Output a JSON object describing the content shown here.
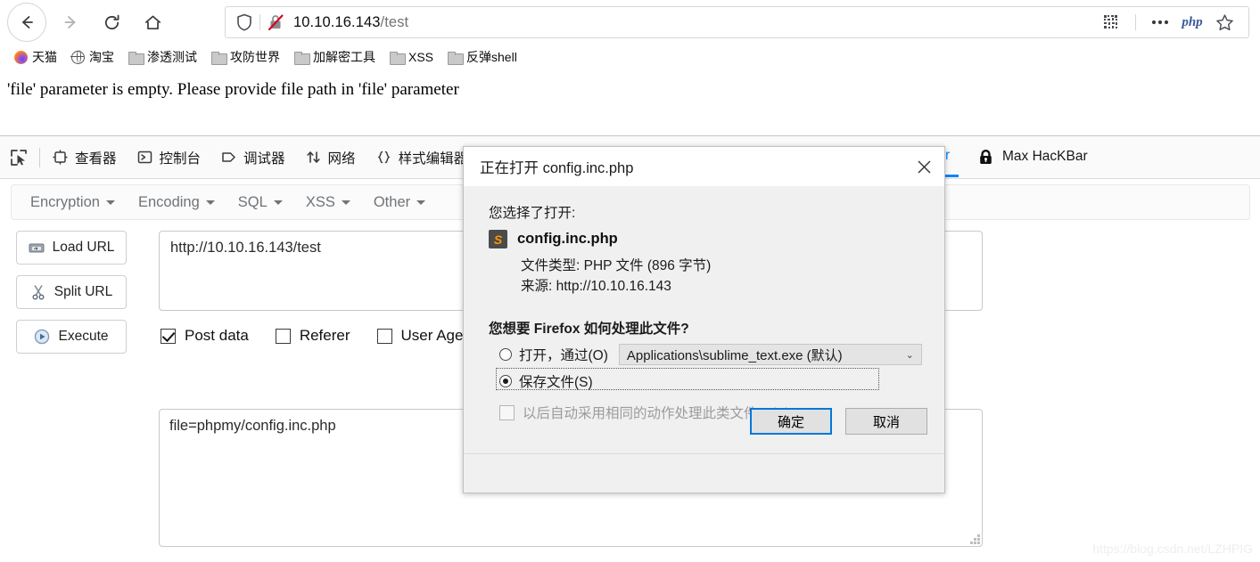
{
  "browser": {
    "nav": {
      "back_label": "←",
      "forward_label": "→",
      "reload_label": "⟳",
      "home_label": "⌂"
    },
    "url_bar": {
      "host": "10.10.16.143",
      "path": "/test",
      "shield_icon": "shield-icon",
      "insecure_icon": "crossed-lock-icon",
      "qr_icon": "qr-code-icon",
      "menu_icon": "ellipsis-icon",
      "php_badge": "php",
      "star_icon": "star-icon"
    },
    "bookmarks": [
      {
        "label": "天猫",
        "icon": "firefox-logo-icon"
      },
      {
        "label": "淘宝",
        "icon": "globe-icon"
      },
      {
        "label": "渗透测试",
        "icon": "folder-icon"
      },
      {
        "label": "攻防世界",
        "icon": "folder-icon"
      },
      {
        "label": "加解密工具",
        "icon": "folder-icon"
      },
      {
        "label": "XSS",
        "icon": "folder-icon"
      },
      {
        "label": "反弹shell",
        "icon": "folder-icon"
      }
    ]
  },
  "page": {
    "message": "'file' parameter is empty. Please provide file path in 'file' parameter"
  },
  "devtools": {
    "picker_icon": "element-picker-icon",
    "tabs": [
      {
        "label": "查看器",
        "icon": "inspector-icon"
      },
      {
        "label": "控制台",
        "icon": "console-icon"
      },
      {
        "label": "调试器",
        "icon": "debugger-icon"
      },
      {
        "label": "网络",
        "icon": "network-icon"
      },
      {
        "label": "样式编辑器",
        "icon": "style-editor-icon"
      }
    ],
    "hackbar_tab_label": "Bar",
    "maxhackbar_tab_label": "Max HacKBar",
    "maxhackbar_icon": "lock-icon"
  },
  "hackbar": {
    "menu": [
      {
        "label": "Encryption"
      },
      {
        "label": "Encoding"
      },
      {
        "label": "SQL"
      },
      {
        "label": "XSS"
      },
      {
        "label": "Other"
      }
    ],
    "buttons": [
      {
        "label": "Load URL",
        "icon": "load-url-icon"
      },
      {
        "label": "Split URL",
        "icon": "scissors-icon"
      },
      {
        "label": "Execute",
        "icon": "play-icon"
      }
    ],
    "url_value": "http://10.10.16.143/test",
    "checkboxes": [
      {
        "label": "Post data",
        "checked": true
      },
      {
        "label": "Referer",
        "checked": false
      },
      {
        "label": "User Agent",
        "checked": false
      }
    ],
    "post_data_value": "file=phpmy/config.inc.php"
  },
  "dialog": {
    "title": "正在打开 config.inc.php",
    "close_icon": "close-icon",
    "you_chose_label": "您选择了打开:",
    "file_name": "config.inc.php",
    "file_icon": "sublime-text-icon",
    "file_type_label": "文件类型:   PHP 文件 (896 字节)",
    "source_label": "来源:   http://10.10.16.143",
    "question": "您想要 Firefox 如何处理此文件?",
    "radio_open_label": "打开，通过(O)",
    "app_select_value": "Applications\\sublime_text.exe (默认)",
    "app_select_chevron": "⌄",
    "radio_save_label": "保存文件(S)",
    "auto_checkbox_label": "以后自动采用相同的动作处理此类文件。(A)",
    "ok_label": "确定",
    "cancel_label": "取消",
    "selected_option": "save"
  },
  "watermark": "https://blog.csdn.net/LZHPIG",
  "colors": {
    "accent_blue": "#0a84ff",
    "focus_blue": "#0078d7",
    "php_badge": "#3b5998",
    "sublime_orange": "#ff9800"
  }
}
